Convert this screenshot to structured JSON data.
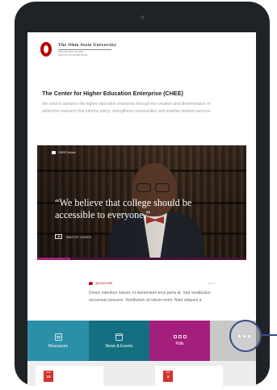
{
  "header": {
    "university": "The Ohio State University",
    "department_line1": "CENTER FOR HIGHER",
    "department_line2": "EDUCATION ENTERPRISE"
  },
  "intro": {
    "title": "The Center for Higher Education Enterprise (CHEE)",
    "body": "We exist to advance the higher education enterprise through the creation and dissemination of distinctive research that informs policy, strengthens communities and enables student success."
  },
  "video": {
    "badge": "CHEE Voices",
    "quote": "“We believe that college should be accessible to everyone.”",
    "watch_label": "WATCH VIDEO",
    "progress": 0.16
  },
  "social": {
    "handle": "@OSUCHEE",
    "date": "Nov 9",
    "text": "Donec interdum rutrum, et elementum eros porta at. Sed vestibulum accumsan posuere. Vestibulum at rutrum enim. Nam aliquam a"
  },
  "nav": {
    "resources": "Resources",
    "news_events": "News & Events",
    "pdfs": "Pdfs"
  },
  "events": [
    {
      "month": "MAR",
      "day": "23"
    },
    {
      "month": "APR",
      "day": "3"
    }
  ],
  "colors": {
    "brand_red": "#bb0000",
    "resources_teal": "#2b8fa8",
    "news_teal": "#146f80",
    "pdfs_magenta": "#a31f7b",
    "highlight_ring": "#3a4a8c"
  }
}
